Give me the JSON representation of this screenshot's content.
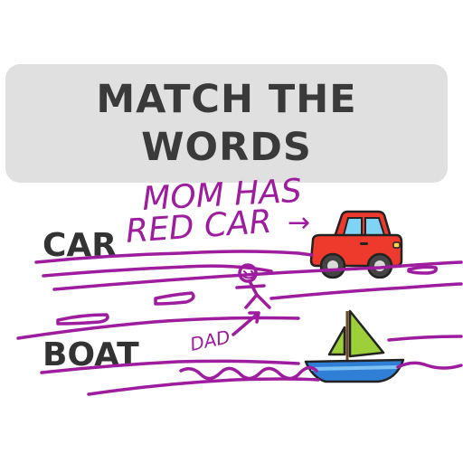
{
  "title": {
    "line1": "MATCH THE",
    "line2": "WORDS"
  },
  "words": {
    "car": "CAR",
    "boat": "BOAT"
  },
  "handwriting": {
    "note_line1": "MOM HAS",
    "note_line2": "RED CAR",
    "note_arrow": "→",
    "dad_note": "DAD"
  },
  "colors": {
    "banner": "#e0e0e0",
    "title_text": "#3a3a3a",
    "word_text": "#333333",
    "scribble": "#9e1c9e",
    "car_body": "#ee3a2c",
    "boat_hull": "#2f7fd6",
    "sail": "#9ccf3a"
  },
  "icons": {
    "car": "red-car-icon",
    "boat": "sailboat-icon",
    "person": "stick-figure-icon"
  }
}
